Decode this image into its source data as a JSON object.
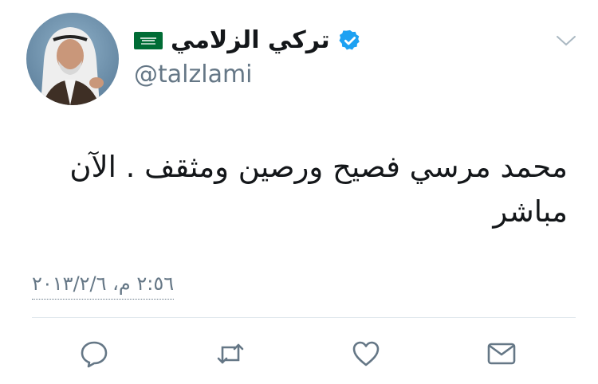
{
  "tweet": {
    "author": {
      "display_name": "تركي الزلامي",
      "handle": "@talzlami",
      "verified": true,
      "flag_icon": "saudi-flag-icon",
      "avatar": "profile-photo"
    },
    "text": "محمد مرسي فصيح ورصين ومثقف . الآن مباشر",
    "timestamp": "٢:٥٦ م، ٢٠١٣/٢/٦"
  },
  "actions": [
    {
      "name": "reply",
      "icon": "reply-icon"
    },
    {
      "name": "retweet",
      "icon": "retweet-icon"
    },
    {
      "name": "like",
      "icon": "heart-icon"
    },
    {
      "name": "message",
      "icon": "envelope-icon"
    }
  ],
  "colors": {
    "accent": "#1da1f2",
    "text": "#14171a",
    "secondary": "#657786",
    "icon": "#657786",
    "flag_green": "#006c35",
    "divider": "#e1e8ed"
  }
}
